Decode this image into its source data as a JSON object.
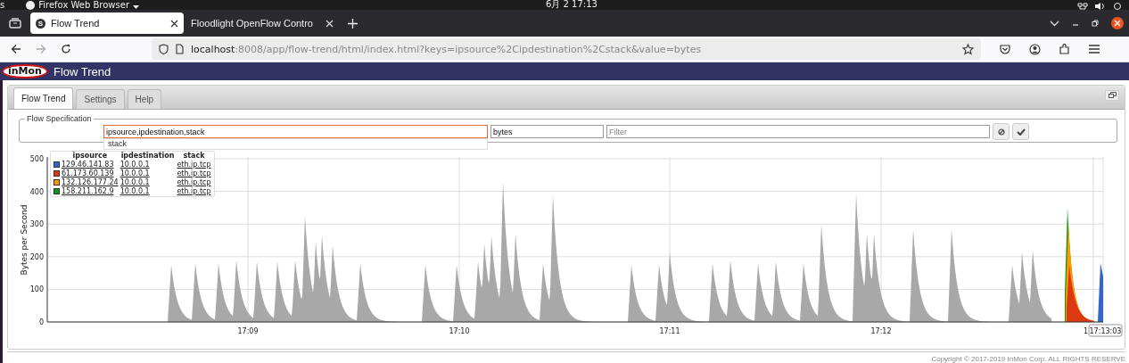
{
  "os_bar": {
    "activities": "s",
    "app": "Firefox Web Browser",
    "clock": "6月 2  17:13"
  },
  "browser_tabs": [
    {
      "title": "Flow Trend",
      "favicon": "S",
      "selected": true
    },
    {
      "title": "Floodlight OpenFlow Contro",
      "selected": false
    }
  ],
  "address": {
    "host": "localhost",
    "rest": ":8008/app/flow-trend/html/index.html?keys=ipsource%2Cipdestination%2Cstack&value=bytes"
  },
  "app_header": {
    "logo": "inMon",
    "title": "Flow Trend"
  },
  "app_tabs": [
    {
      "label": "Flow Trend",
      "selected": true
    },
    {
      "label": "Settings",
      "selected": false
    },
    {
      "label": "Help",
      "selected": false
    }
  ],
  "flow_spec": {
    "legend": "Flow Specification",
    "keys": "ipsource,ipdestination,stack",
    "value": "bytes",
    "filter_placeholder": "Filter",
    "suggestions": [
      "stack"
    ]
  },
  "chart": {
    "ylabel": "Bytes per Second",
    "yticks": [
      "500",
      "400",
      "300",
      "200",
      "100",
      "0"
    ],
    "xticks": [
      "17:09",
      "17:10",
      "17:11",
      "17:12"
    ],
    "cut_tick": "1",
    "time_cursor": "17:13:03",
    "legend": {
      "columns": [
        "ipsource",
        "ipdestination",
        "stack"
      ],
      "rows": [
        {
          "color": "#3366cc",
          "ipsource": "129.46.141.83",
          "ipdestination": "10.0.0.1",
          "stack": "eth.ip.tcp"
        },
        {
          "color": "#dc3912",
          "ipsource": "61.173.60.139",
          "ipdestination": "10.0.0.1",
          "stack": "eth.ip.tcp"
        },
        {
          "color": "#ff9900",
          "ipsource": "132.126.177.24",
          "ipdestination": "10.0.0.1",
          "stack": "eth.ip.tcp"
        },
        {
          "color": "#109618",
          "ipsource": "158.211.162.9",
          "ipdestination": "10.0.0.1",
          "stack": "eth.ip.tcp"
        }
      ]
    }
  },
  "footer": "Copyright © 2017-2019 InMon Corp. ALL RIGHTS RESERVE"
}
